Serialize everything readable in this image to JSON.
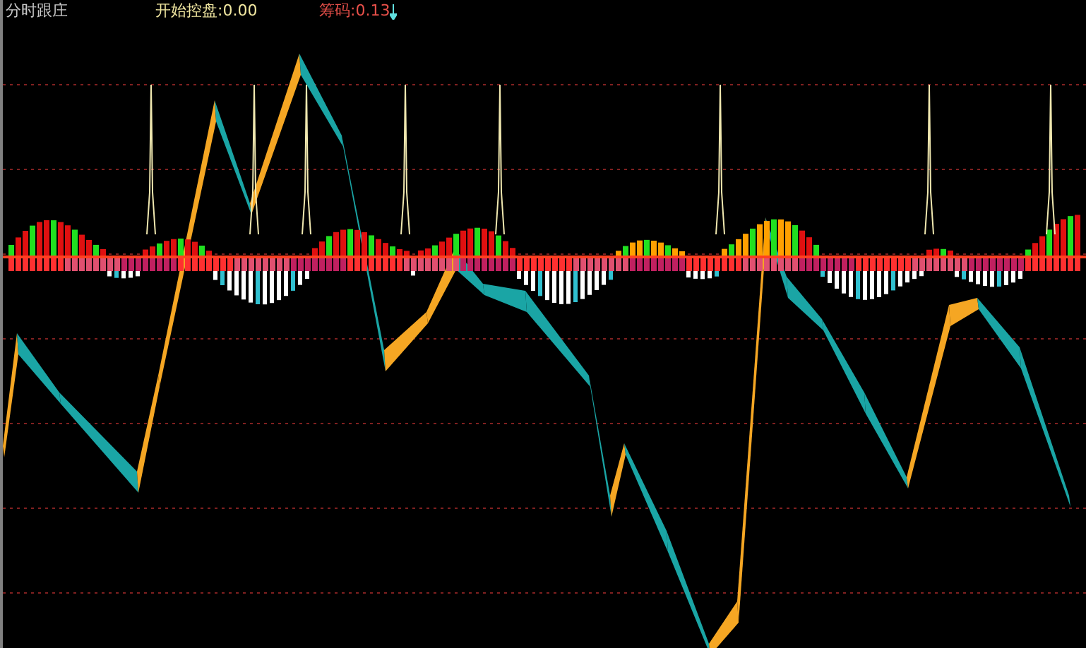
{
  "header": {
    "title": "分时跟庄",
    "indicators": [
      {
        "kind": "control",
        "label": "开始控盘:0.00"
      },
      {
        "kind": "chips",
        "label": "筹码:0.13"
      }
    ]
  }
}
